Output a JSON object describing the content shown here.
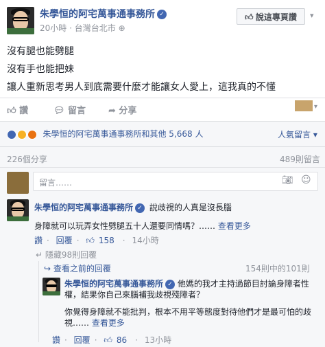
{
  "post": {
    "page_name": "朱學恒的阿宅萬事通事務所",
    "time": "20小時",
    "location": "台灣台北市",
    "like_page_button": "說這專頁讚",
    "lines": [
      "沒有腿也能劈腿",
      "沒有手也能把妹",
      "讓人重新思考男人到底需要什麼才能讓女人愛上，這我真的不懂"
    ]
  },
  "actions": {
    "like": "讚",
    "comment": "留言",
    "share": "分享"
  },
  "reactions": {
    "summary": "朱學恒的阿宅萬事通事務所和其他 5,668 人",
    "sort_label": "人氣留言",
    "colors": [
      "#4267b2",
      "#f7b125",
      "#e9710f"
    ]
  },
  "stats": {
    "shares": "226個分享",
    "comment_count": "489則留言"
  },
  "composer": {
    "placeholder": "留言……"
  },
  "comments": [
    {
      "author": "朱學恒的阿宅萬事通事務所",
      "headline": "說歧視的人真是沒長腦",
      "body": "身障就可以玩弄女性劈腿五十人還要同情嗎？……",
      "see_more": "查看更多",
      "like": "讚",
      "reply": "回覆",
      "likes": "158",
      "time": "14小時"
    }
  ],
  "hidden_replies": "隱藏98則回覆",
  "view_previous": "查看之前的回覆",
  "reply_progress": "154則中的101則",
  "reply": {
    "author": "朱學恒的阿宅萬事通事務所",
    "body1": "他媽的我才主持過節目討論身障者性權，結果你自己來腦補我歧視殘障者？",
    "body2": "你覺得身障就不能批判，根本不用平等態度對待他們才是最可怕的歧視……",
    "see_more": "查看更多",
    "like": "讚",
    "reply": "回覆",
    "likes": "86",
    "time": "13小時"
  }
}
